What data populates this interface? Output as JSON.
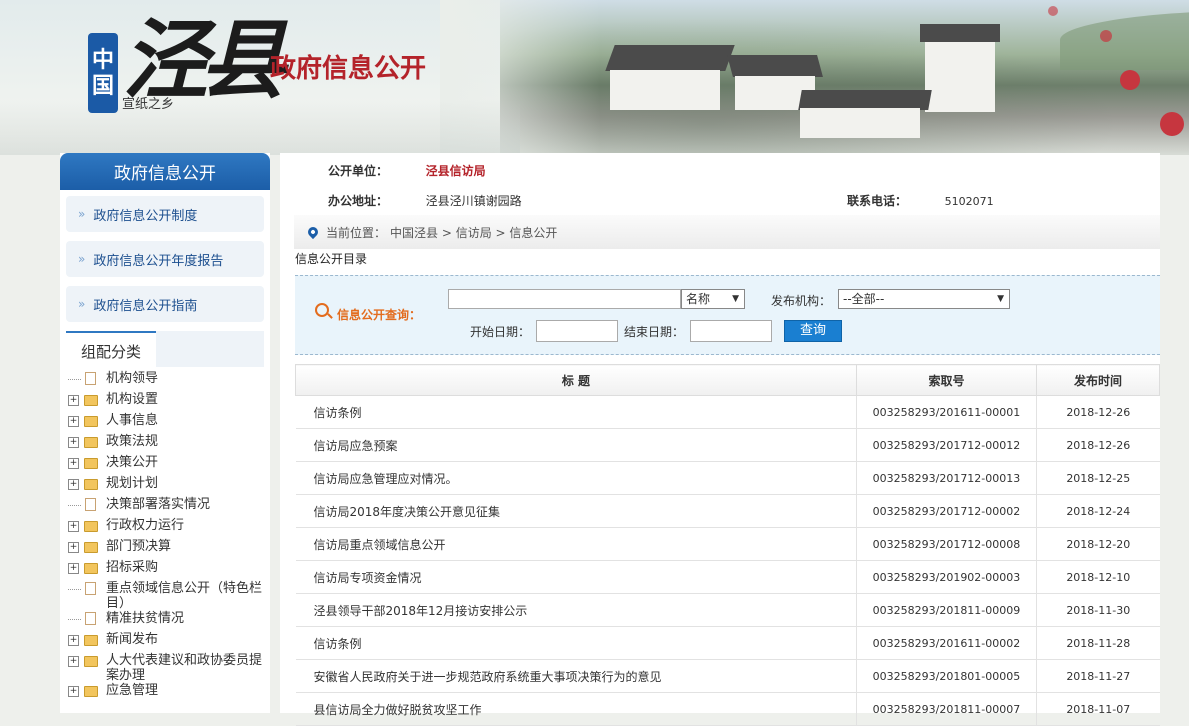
{
  "header": {
    "logo_zhong": "中国",
    "logo_main": "泾县",
    "logo_sub": "宣纸之乡",
    "title": "政府信息公开"
  },
  "sidebar": {
    "title": "政府信息公开",
    "links": [
      "政府信息公开制度",
      "政府信息公开年度报告",
      "政府信息公开指南"
    ],
    "category_tab": "组配分类",
    "tree": [
      {
        "label": "机构领导",
        "type": "page"
      },
      {
        "label": "机构设置",
        "type": "folder"
      },
      {
        "label": "人事信息",
        "type": "folder"
      },
      {
        "label": "政策法规",
        "type": "folder"
      },
      {
        "label": "决策公开",
        "type": "folder"
      },
      {
        "label": "规划计划",
        "type": "folder"
      },
      {
        "label": "决策部署落实情况",
        "type": "page"
      },
      {
        "label": "行政权力运行",
        "type": "folder"
      },
      {
        "label": "部门预决算",
        "type": "folder"
      },
      {
        "label": "招标采购",
        "type": "folder"
      },
      {
        "label": "重点领域信息公开（特色栏目）",
        "type": "page"
      },
      {
        "label": "精准扶贫情况",
        "type": "page"
      },
      {
        "label": "新闻发布",
        "type": "folder"
      },
      {
        "label": "人大代表建议和政协委员提案办理",
        "type": "folder"
      },
      {
        "label": "应急管理",
        "type": "folder"
      }
    ]
  },
  "info": {
    "unit_label": "公开单位：",
    "unit_value": "泾县信访局",
    "address_label": "办公地址：",
    "address_value": "泾县泾川镇谢园路",
    "phone_label": "联系电话：",
    "phone_value": "5102071"
  },
  "breadcrumb": {
    "prefix": "当前位置：",
    "path": "中国泾县 > 信访局 > 信息公开"
  },
  "directory_label": "信息公开目录",
  "search": {
    "label": "信息公开查询：",
    "keyword_value": "",
    "field_select": "名称",
    "org_label": "发布机构：",
    "org_select": "--全部--",
    "start_label": "开始日期：",
    "end_label": "结束日期：",
    "submit": "查询"
  },
  "table": {
    "headers": [
      "标  题",
      "索取号",
      "发布时间"
    ],
    "rows": [
      {
        "title": "信访条例",
        "no": "003258293/201611-00001",
        "date": "2018-12-26"
      },
      {
        "title": "信访局应急预案",
        "no": "003258293/201712-00012",
        "date": "2018-12-26"
      },
      {
        "title": "信访局应急管理应对情况。",
        "no": "003258293/201712-00013",
        "date": "2018-12-25"
      },
      {
        "title": "信访局2018年度决策公开意见征集",
        "no": "003258293/201712-00002",
        "date": "2018-12-24"
      },
      {
        "title": "信访局重点领域信息公开",
        "no": "003258293/201712-00008",
        "date": "2018-12-20"
      },
      {
        "title": "信访局专项资金情况",
        "no": "003258293/201902-00003",
        "date": "2018-12-10"
      },
      {
        "title": "泾县领导干部2018年12月接访安排公示",
        "no": "003258293/201811-00009",
        "date": "2018-11-30"
      },
      {
        "title": "信访条例",
        "no": "003258293/201611-00002",
        "date": "2018-11-28"
      },
      {
        "title": "安徽省人民政府关于进一步规范政府系统重大事项决策行为的意见",
        "no": "003258293/201801-00005",
        "date": "2018-11-27"
      },
      {
        "title": "县信访局全力做好脱贫攻坚工作",
        "no": "003258293/201811-00007",
        "date": "2018-11-07"
      }
    ]
  },
  "colors": {
    "brand_blue": "#1c5ea8",
    "title_red": "#b4232a",
    "search_orange": "#e36c1e",
    "button_blue": "#1a7fd1"
  }
}
